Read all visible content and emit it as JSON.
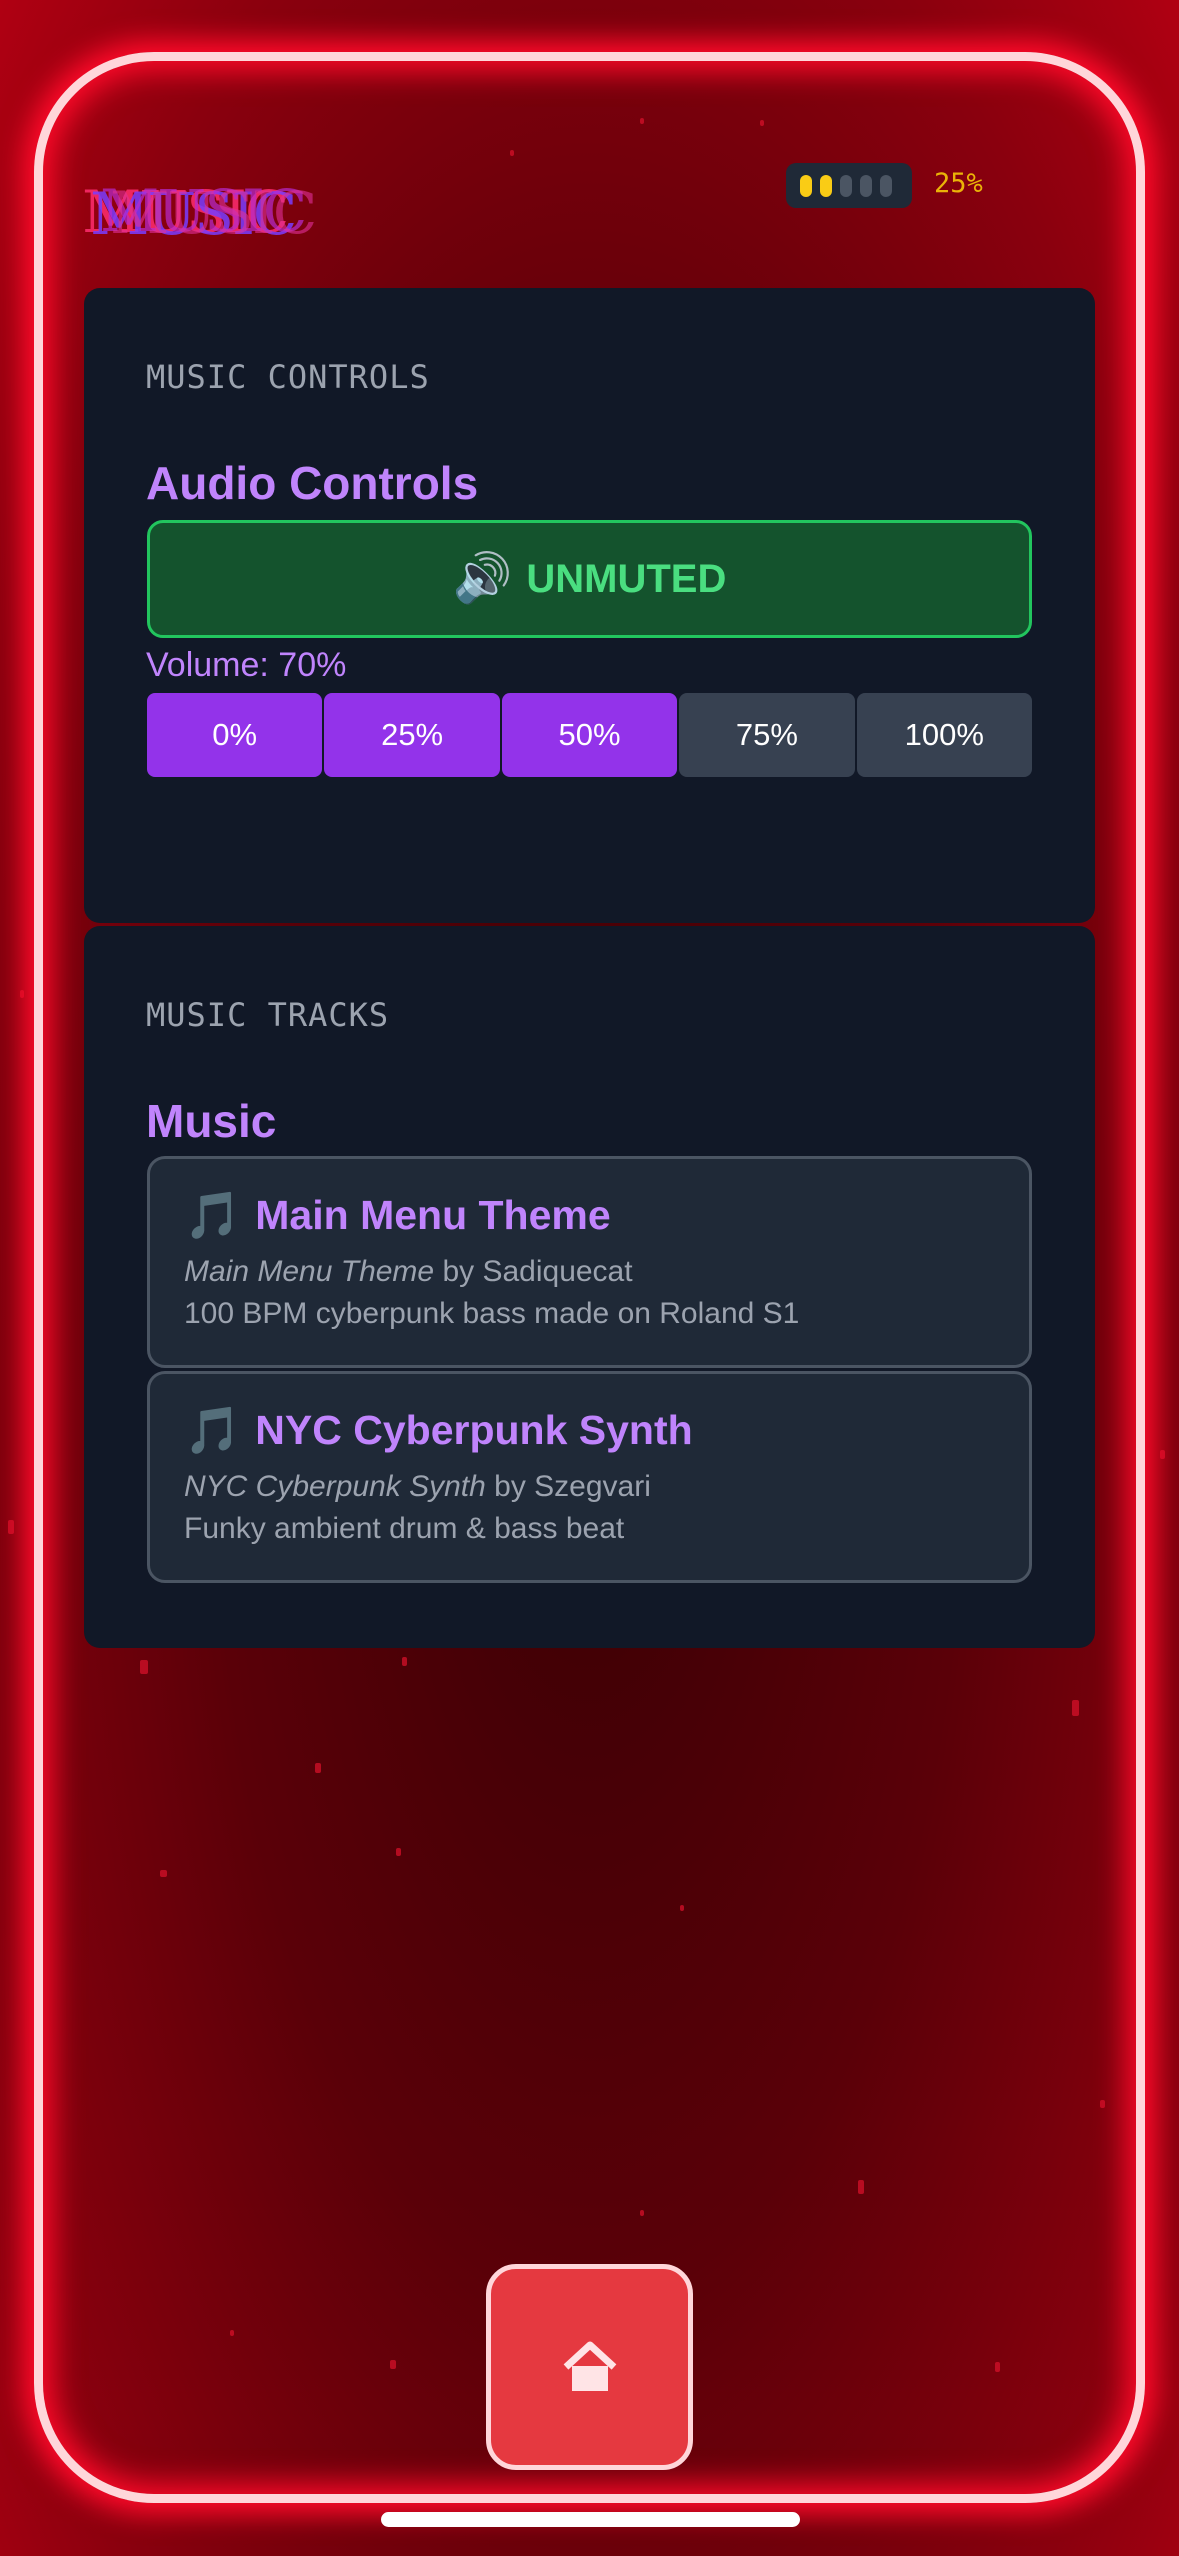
{
  "app": {
    "logo_text": "MUSIC",
    "battery": {
      "level_percent": 25,
      "label": "25%",
      "cells_total": 5,
      "cells_filled": 2,
      "fill_color": "#facc15"
    }
  },
  "controls_panel": {
    "section_label": "MUSIC CONTROLS",
    "heading": "Audio Controls",
    "mute_button": {
      "icon": "speaker-icon",
      "glyph": "🔊",
      "label": "UNMUTED",
      "color": "#22c55e"
    },
    "volume_label": "Volume: 70%",
    "volume_level_percent": 70,
    "volume_options": [
      {
        "label": "0%",
        "active": true
      },
      {
        "label": "25%",
        "active": true
      },
      {
        "label": "50%",
        "active": true
      },
      {
        "label": "75%",
        "active": false
      },
      {
        "label": "100%",
        "active": false
      }
    ]
  },
  "tracks_panel": {
    "section_label": "MUSIC TRACKS",
    "heading": "Music",
    "tracks": [
      {
        "icon": "music-note-icon",
        "glyph": "🎵",
        "title": "Main Menu Theme",
        "credit_title": "Main Menu Theme",
        "credit_by": " by Sadiquecat",
        "description": "100 BPM cyberpunk bass made on Roland S1"
      },
      {
        "icon": "music-note-icon",
        "glyph": "🎵",
        "title": "NYC Cyberpunk Synth",
        "credit_title": "NYC Cyberpunk Synth",
        "credit_by": " by Szegvari",
        "description": "Funky ambient drum & bass beat"
      }
    ]
  },
  "home_button": {
    "icon": "home-icon"
  },
  "colors": {
    "accent_purple": "#c084fc",
    "active_purple": "#9333ea",
    "neon_red": "#ff0a2a",
    "home_red": "#e53940"
  }
}
